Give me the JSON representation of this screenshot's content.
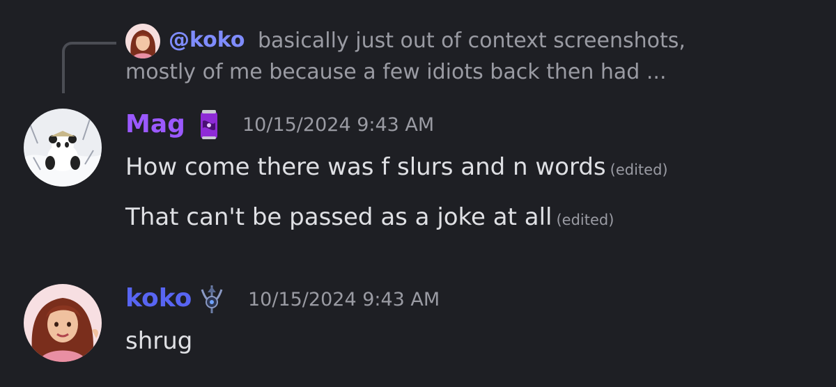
{
  "reply": {
    "mention": "@koko",
    "text": "basically just out of context screenshots, mostly of me because a few idiots back then had ..."
  },
  "messages": [
    {
      "author": "Mag",
      "author_color": "#9b59ff",
      "timestamp": "10/15/2024 9:43 AM",
      "badge_icon": "purple-soda-can",
      "lines": [
        {
          "text": "How come there was f slurs and n words",
          "edited": "(edited)"
        },
        {
          "text": "That can't be passed as a joke at all",
          "edited": "(edited)"
        }
      ]
    },
    {
      "author": "koko",
      "author_color": "#5865f2",
      "timestamp": "10/15/2024 9:43 AM",
      "badge_icon": "guild-crest",
      "lines": [
        {
          "text": "shrug"
        }
      ]
    }
  ]
}
